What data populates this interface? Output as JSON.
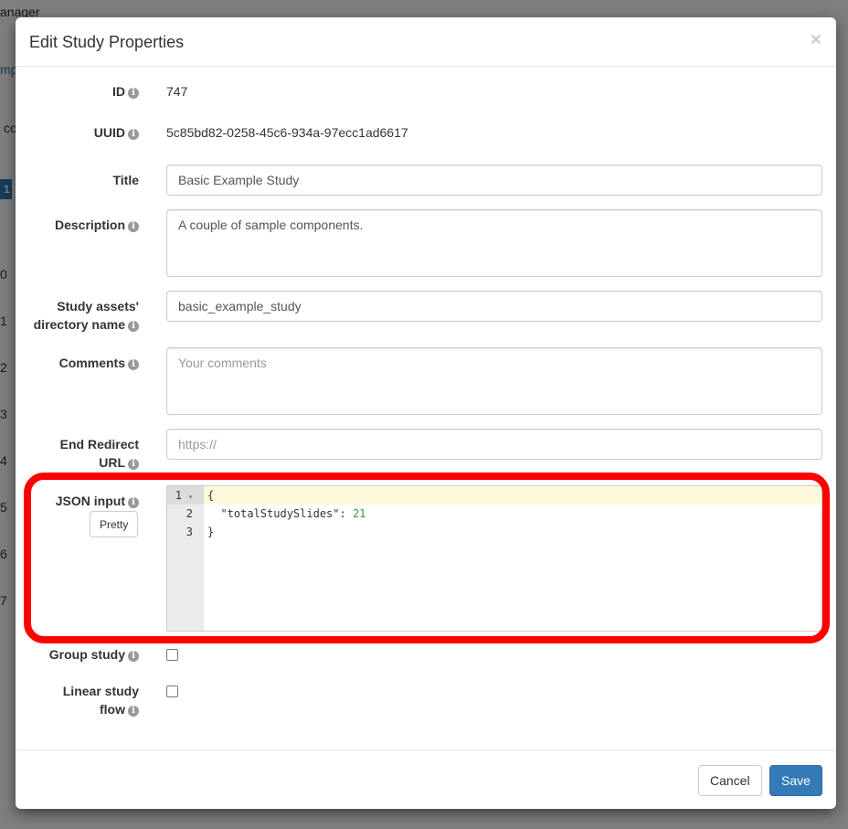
{
  "background": {
    "fragments": [
      "anager",
      "mp",
      "co",
      "1",
      "0",
      "1",
      "2",
      "3",
      "4",
      "5",
      "6",
      "7"
    ]
  },
  "modal": {
    "title": "Edit Study Properties",
    "close": "×",
    "fields": {
      "id": {
        "label": "ID",
        "value": "747"
      },
      "uuid": {
        "label": "UUID",
        "value": "5c85bd82-0258-45c6-934a-97ecc1ad6617"
      },
      "title": {
        "label": "Title",
        "value": "Basic Example Study"
      },
      "description": {
        "label": "Description",
        "value": "A couple of sample components."
      },
      "assets_dir": {
        "label_line1": "Study assets'",
        "label_line2": "directory name",
        "value": "basic_example_study"
      },
      "comments": {
        "label": "Comments",
        "placeholder": "Your comments"
      },
      "end_redirect": {
        "label_line1": "End Redirect",
        "label_line2": "URL",
        "placeholder": "https://"
      },
      "json": {
        "label": "JSON input",
        "pretty_button": "Pretty",
        "line_numbers": [
          "1",
          "2",
          "3"
        ],
        "lines": [
          "{",
          "  \"totalStudySlides\": ",
          "}"
        ],
        "number_value": "21"
      },
      "group_study": {
        "label": "Group study",
        "checked": false
      },
      "linear_flow": {
        "label_line1": "Linear study",
        "label_line2": "flow",
        "checked": false
      }
    },
    "info_icon": "i",
    "cancel": "Cancel",
    "save": "Save",
    "highlight_color": "#ff0000",
    "save_color": "#337ab7"
  }
}
